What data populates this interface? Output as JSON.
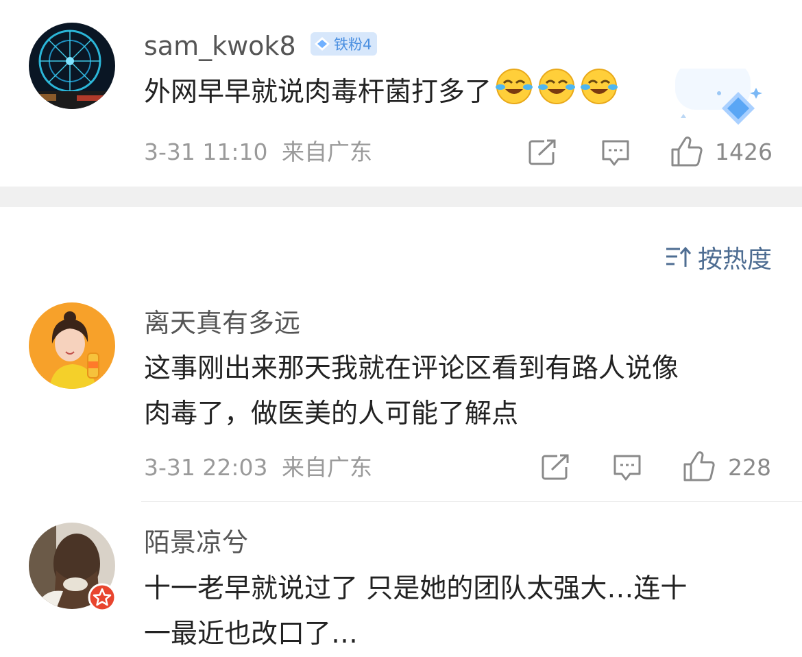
{
  "top_comment": {
    "username": "sam_kwok8",
    "badge": "铁粉4",
    "text": "外网早早就说肉毒杆菌打多了",
    "emoji_icons": [
      "laughing-tears-emoji",
      "laughing-tears-emoji",
      "laughing-tears-emoji"
    ],
    "time": "3-31 11:10",
    "location": "来自广东",
    "likes": "1426"
  },
  "sort": {
    "label": "按热度",
    "icon": "sort-lines-icon"
  },
  "comments": [
    {
      "username": "离天真有多远",
      "text_line1": "这事刚出来那天我就在评论区看到有路人说像",
      "text_line2": "肉毒了，做医美的人可能了解点",
      "time": "3-31 22:03",
      "location": "来自广东",
      "likes": "228"
    },
    {
      "username": "陌景凉兮",
      "text_line1": "十一老早就说过了 只是她的团队太强大…连十",
      "text_line2": "一最近也改口了…"
    }
  ],
  "colors": {
    "badge_bg": "#d7e7fb",
    "badge_text": "#4a8fe0",
    "sort_accent": "#4e6d92",
    "meta_gray": "#9a9a9a"
  }
}
